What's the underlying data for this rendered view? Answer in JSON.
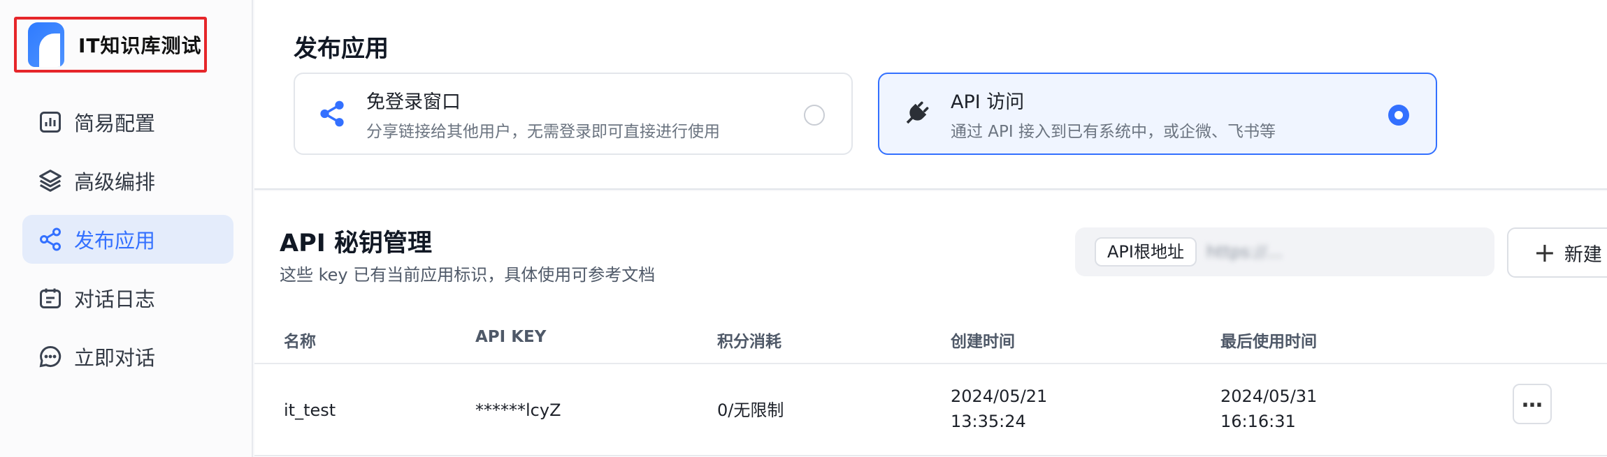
{
  "app": {
    "title": "IT知识库测试"
  },
  "sidebar": {
    "items": [
      {
        "label": "简易配置",
        "icon": "bar-chart-icon"
      },
      {
        "label": "高级编排",
        "icon": "layers-icon"
      },
      {
        "label": "发布应用",
        "icon": "share-icon",
        "active": true
      },
      {
        "label": "对话日志",
        "icon": "calendar-log-icon"
      },
      {
        "label": "立即对话",
        "icon": "chat-bubble-icon"
      }
    ]
  },
  "publish": {
    "title": "发布应用",
    "options": [
      {
        "title": "免登录窗口",
        "desc": "分享链接给其他用户，无需登录即可直接进行使用",
        "icon": "share-icon",
        "selected": false
      },
      {
        "title": "API 访问",
        "desc": "通过 API 接入到已有系统中，或企微、飞书等",
        "icon": "plug-icon",
        "selected": true
      }
    ]
  },
  "api_keys": {
    "title": "API 秘钥管理",
    "subtitle": "这些 key 已有当前应用标识，具体使用可参考文档",
    "base_url_label": "API根地址",
    "base_url_value": "https://...",
    "new_button_label": "新建",
    "columns": [
      "名称",
      "API KEY",
      "积分消耗",
      "创建时间",
      "最后使用时间"
    ],
    "rows": [
      {
        "name": "it_test",
        "key": "******lcyZ",
        "usage": "0/无限制",
        "created_date": "2024/05/21",
        "created_time": "13:35:24",
        "last_used_date": "2024/05/31",
        "last_used_time": "16:16:31"
      }
    ]
  },
  "colors": {
    "accent": "#3370ff",
    "highlight_border": "#e6262a"
  }
}
